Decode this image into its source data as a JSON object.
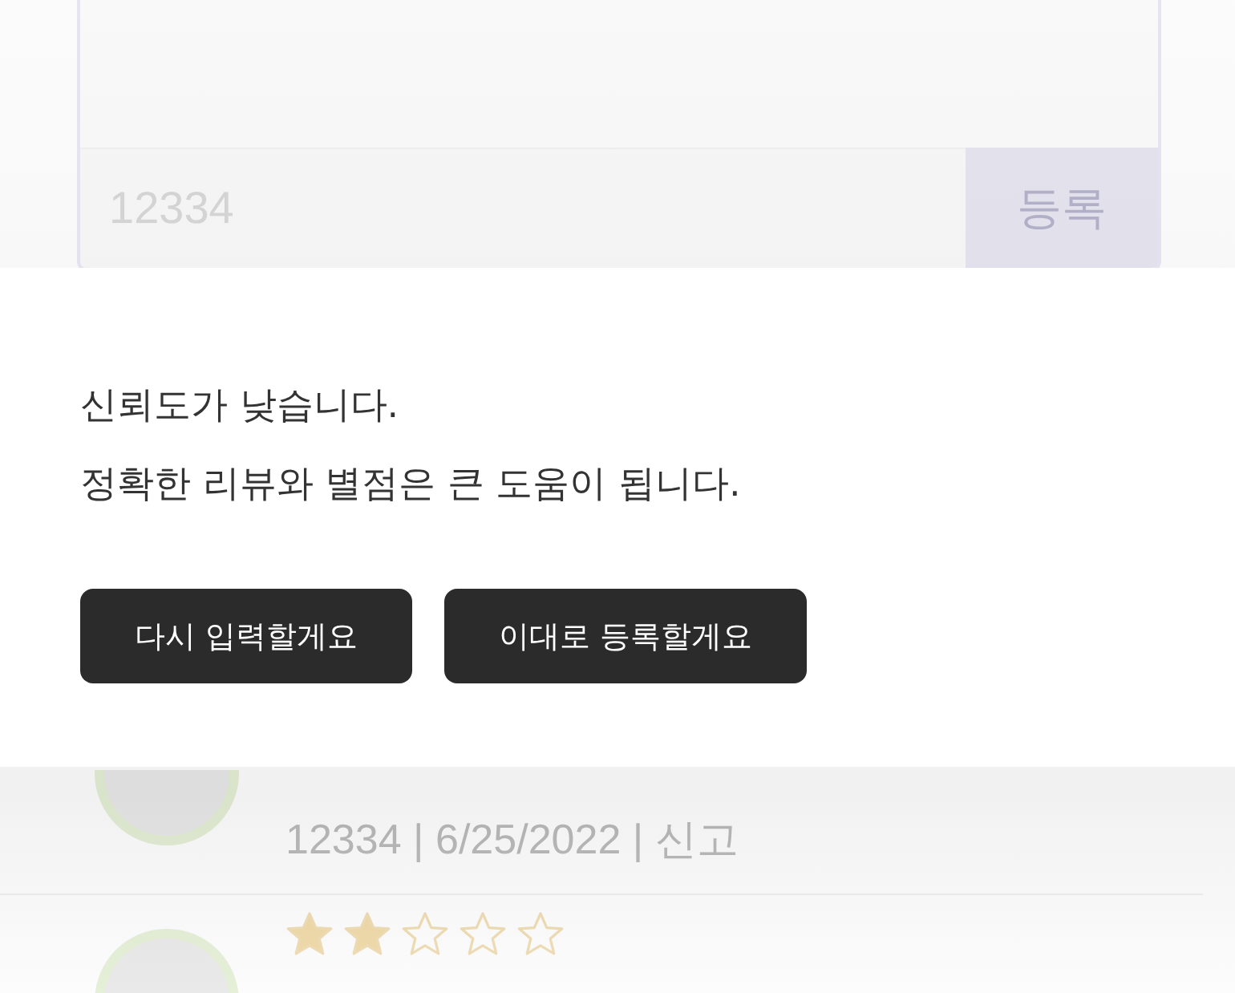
{
  "comment_form": {
    "value": "12334",
    "submit_button": "등록"
  },
  "dialog": {
    "lines": [
      "신뢰도가 낮습니다.",
      "정확한 리뷰와 별점은 큰 도움이 됩니다."
    ],
    "buttons": [
      {
        "label": "다시 입력할게요"
      },
      {
        "label": "이대로 등록할게요"
      }
    ]
  },
  "reviews": [
    {
      "meta": "12334 | 6/25/2022 | 신고"
    },
    {
      "stars": 2
    }
  ]
}
